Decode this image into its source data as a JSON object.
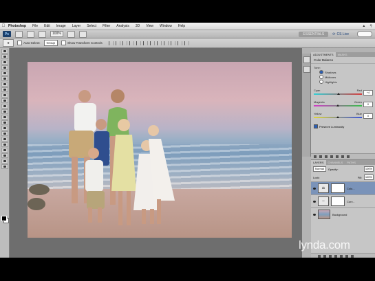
{
  "menu": {
    "app_name": "Photoshop",
    "items": [
      "File",
      "Edit",
      "Image",
      "Layer",
      "Select",
      "Filter",
      "Analysis",
      "3D",
      "View",
      "Window",
      "Help"
    ]
  },
  "appbar": {
    "zoom": "100%",
    "workspace": "ESSENTIALS",
    "cs_live": "CS Live"
  },
  "options": {
    "auto_select": "Auto-Select:",
    "auto_select_value": "Group",
    "show_transform": "Show Transform Controls"
  },
  "adjustments": {
    "tabs": [
      "ADJUSTMENTS",
      "MASKS"
    ],
    "title": "Color Balance",
    "tone_label": "Tone:",
    "tones": [
      "Shadows",
      "Midtones",
      "Highlights"
    ],
    "selected_tone": "Shadows",
    "sliders": [
      {
        "left": "Cyan",
        "right": "Red",
        "value": "+4",
        "position": 0.52
      },
      {
        "left": "Magenta",
        "right": "Green",
        "value": "0",
        "position": 0.5
      },
      {
        "left": "Yellow",
        "right": "Blue",
        "value": "0",
        "position": 0.5
      }
    ],
    "preserve_luminosity": "Preserve Luminosity"
  },
  "layers": {
    "tabs": [
      "LAYERS",
      "CHANNELS",
      "PATHS"
    ],
    "blend_mode": "Normal",
    "opacity_label": "Opacity:",
    "opacity": "100%",
    "fill_label": "Fill:",
    "fill": "100%",
    "lock_label": "Lock:",
    "rows": [
      {
        "name": "Colo...",
        "type": "adjustment",
        "selected": true
      },
      {
        "name": "Curv...",
        "type": "adjustment",
        "selected": false
      },
      {
        "name": "Background",
        "type": "image",
        "selected": false
      }
    ]
  },
  "watermark": "lynda.com"
}
